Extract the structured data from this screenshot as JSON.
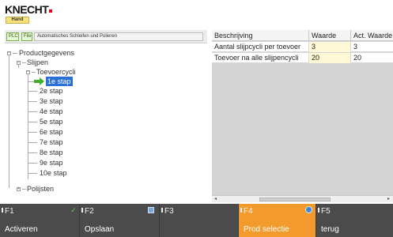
{
  "header": {
    "logo_text": "KNECHT",
    "mode": "Hand",
    "brand_color": "#e2001a"
  },
  "toolbar": {
    "plc_label": "PLC",
    "file_label": "File",
    "mode_label": "Automatisches Schleifen und Polieren"
  },
  "tree": {
    "root": "Productgegevens",
    "slijpen": "Slijpen",
    "toevoer": "Toevoercycli",
    "steps": [
      "1e stap",
      "2e stap",
      "3e stap",
      "4e stap",
      "5e stap",
      "6e stap",
      "7e stap",
      "8e stap",
      "9e stap",
      "10e stap"
    ],
    "selected_step": "1e stap",
    "polijsten": "Polijsten"
  },
  "grid": {
    "headers": [
      "Beschrijving",
      "Waarde",
      "Act. Waarde"
    ],
    "rows": [
      {
        "desc": "Aantal slijpcycli per toevoer",
        "value": "3",
        "actual": "3"
      },
      {
        "desc": "Toevoer na alle slijpencycli",
        "value": "20",
        "actual": "20"
      }
    ]
  },
  "fkeys": [
    {
      "key": "F1",
      "label": "Activeren",
      "icon": "check-icon"
    },
    {
      "key": "F2",
      "label": "Opslaan",
      "icon": "save-icon"
    },
    {
      "key": "F3",
      "label": "",
      "icon": ""
    },
    {
      "key": "F4",
      "label": "Prod selectie",
      "icon": "globe-icon",
      "active": true
    },
    {
      "key": "F5",
      "label": "terug",
      "icon": ""
    }
  ],
  "colors": {
    "accent": "#f39a2c",
    "selection": "#2a6fd6",
    "fkey_bg": "#4b4b4b"
  }
}
